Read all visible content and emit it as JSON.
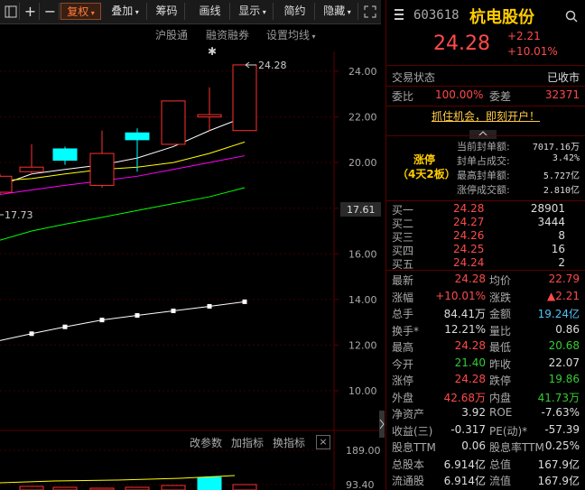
{
  "toolbar": {
    "fold_icon": "fold-icon",
    "plus": "+",
    "minus": "−",
    "restore": "复权",
    "overlay": "叠加",
    "chips": "筹码",
    "draw": "画线",
    "display": "显示",
    "simple": "简约",
    "hide": "隐藏",
    "expand_icon": "expand-icon"
  },
  "chart": {
    "links": {
      "hk_connect": "沪股通",
      "margin": "融资融券",
      "ma_settings": "设置均线"
    },
    "high_label": "24.28",
    "low_label": "17.73",
    "current_price_tag": "17.61",
    "star": "✱",
    "sub_links": {
      "change_param": "改参数",
      "add_indicator": "加指标",
      "switch_indicator": "换指标"
    },
    "sub_close": "×",
    "colors": {
      "up": "#ff3030",
      "down": "#00ffff",
      "ma5": "#ffffff",
      "ma10": "#ffff00",
      "ma20": "#ff00ff",
      "ma60": "#00ff00"
    }
  },
  "chart_data": {
    "type": "candlestick",
    "y_axis_ticks": [
      "24.00",
      "22.00",
      "20.00",
      "18.00",
      "16.00",
      "14.00",
      "12.00",
      "10.00"
    ],
    "volume_axis_ticks": [
      "189.00",
      "93.40"
    ],
    "ylim": [
      9.0,
      25.5
    ],
    "candles": [
      {
        "open": 19.4,
        "close": 18.7,
        "high": 19.5,
        "low": 18.6,
        "color": "up"
      },
      {
        "open": 19.6,
        "close": 19.8,
        "high": 20.8,
        "low": 19.5,
        "color": "up"
      },
      {
        "open": 20.1,
        "close": 20.6,
        "high": 20.7,
        "low": 19.9,
        "color": "down"
      },
      {
        "open": 19.0,
        "close": 20.4,
        "high": 21.4,
        "low": 18.9,
        "color": "up"
      },
      {
        "open": 21.0,
        "close": 21.3,
        "high": 21.5,
        "low": 19.6,
        "color": "down"
      },
      {
        "open": 20.8,
        "close": 22.7,
        "high": 22.7,
        "low": 20.8,
        "color": "up"
      },
      {
        "open": 22.0,
        "close": 22.1,
        "high": 23.3,
        "low": 21.4,
        "color": "up"
      },
      {
        "open": 21.4,
        "close": 24.28,
        "high": 24.28,
        "low": 21.4,
        "color": "up"
      }
    ],
    "ma_lines": {
      "ma5": [
        19.0,
        19.5,
        19.7,
        19.9,
        20.2,
        20.7,
        21.4,
        22.0
      ],
      "ma10": [
        19.2,
        19.3,
        19.5,
        19.7,
        19.8,
        20.0,
        20.4,
        20.9
      ],
      "ma20": [
        18.6,
        18.8,
        19.0,
        19.2,
        19.4,
        19.7,
        20.0,
        20.3
      ],
      "ma60": [
        16.6,
        17.0,
        17.3,
        17.6,
        17.9,
        18.2,
        18.5,
        18.9
      ]
    },
    "dot_line": [
      12.2,
      12.5,
      12.8,
      13.1,
      13.3,
      13.5,
      13.7,
      13.9
    ]
  },
  "quote": {
    "code": "603618",
    "name": "杭电股份",
    "price": "24.28",
    "change": "+2.21",
    "change_pct": "+10.01%",
    "status_label": "交易状态",
    "status_value": "已收市",
    "ratio_label": "委比",
    "ratio_value": "100.00%",
    "diff_label": "委差",
    "diff_value": "32371",
    "ad_link": "抓住机会，即刻开户！",
    "limit_tag": "涨停",
    "limit_days": "（4天2板）",
    "limit_items": [
      {
        "label": "当前封单额:",
        "value": "7017.16万"
      },
      {
        "label": "封单占成交:",
        "value": "3.42%"
      },
      {
        "label": "最高封单额:",
        "value": "5.727亿"
      },
      {
        "label": "涨停成交额:",
        "value": "2.810亿"
      }
    ],
    "bids": [
      {
        "label": "买一",
        "price": "24.28",
        "vol": "28901"
      },
      {
        "label": "买二",
        "price": "24.27",
        "vol": "3444"
      },
      {
        "label": "买三",
        "price": "24.26",
        "vol": "8"
      },
      {
        "label": "买四",
        "price": "24.25",
        "vol": "16"
      },
      {
        "label": "买五",
        "price": "24.24",
        "vol": "2"
      }
    ],
    "stats": [
      {
        "l1": "最新",
        "v1": "24.28",
        "c1": "red",
        "l2": "均价",
        "v2": "22.79",
        "c2": "red"
      },
      {
        "l1": "涨幅",
        "v1": "+10.01%",
        "c1": "red",
        "l2": "涨跌",
        "v2": "▲2.21",
        "c2": "red"
      },
      {
        "l1": "总手",
        "v1": "84.41万",
        "c1": "white",
        "l2": "金额",
        "v2": "19.24亿",
        "c2": "cyan"
      },
      {
        "l1": "换手*",
        "v1": "12.21%",
        "c1": "white",
        "l2": "量比",
        "v2": "0.86",
        "c2": "white"
      },
      {
        "l1": "最高",
        "v1": "24.28",
        "c1": "red",
        "l2": "最低",
        "v2": "20.68",
        "c2": "green"
      },
      {
        "l1": "今开",
        "v1": "21.40",
        "c1": "green",
        "l2": "昨收",
        "v2": "22.07",
        "c2": "white"
      },
      {
        "l1": "涨停",
        "v1": "24.28",
        "c1": "red",
        "l2": "跌停",
        "v2": "19.86",
        "c2": "green"
      },
      {
        "l1": "外盘",
        "v1": "42.68万",
        "c1": "red",
        "l2": "内盘",
        "v2": "41.73万",
        "c2": "green"
      },
      {
        "l1": "净资产",
        "v1": "3.92",
        "c1": "white",
        "l2": "ROE",
        "v2": "-7.63%",
        "c2": "white"
      },
      {
        "l1": "收益(三)",
        "v1": "-0.317",
        "c1": "white",
        "l2": "PE(动)*",
        "v2": "-57.39",
        "c2": "white"
      },
      {
        "l1": "股息TTM",
        "v1": "0.06",
        "c1": "white",
        "l2": "股息率TTM",
        "v2": "0.25%",
        "c2": "white"
      },
      {
        "l1": "总股本",
        "v1": "6.914亿",
        "c1": "white",
        "l2": "总值",
        "v2": "167.9亿",
        "c2": "white"
      },
      {
        "l1": "流通股",
        "v1": "6.914亿",
        "c1": "white",
        "l2": "流值",
        "v2": "167.9亿",
        "c2": "white"
      }
    ]
  }
}
